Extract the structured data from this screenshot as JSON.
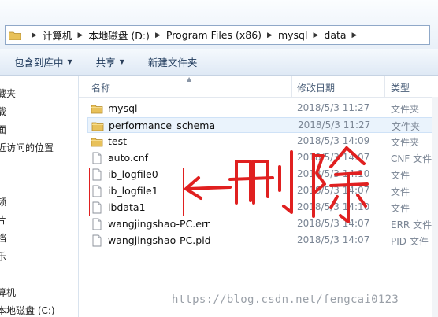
{
  "address_bar": {
    "crumbs": [
      "计算机",
      "本地磁盘 (D:)",
      "Program Files (x86)",
      "mysql",
      "data"
    ]
  },
  "toolbar": {
    "include_in_library": "包含到库中",
    "share": "共享",
    "new_folder": "新建文件夹"
  },
  "nav_pane": {
    "items": [
      "藏夹",
      "载",
      "面",
      "近访问的位置",
      "频",
      "片",
      "档",
      "乐",
      "算机",
      "本地磁盘 (C:)"
    ]
  },
  "columns": {
    "name": "名称",
    "modified": "修改日期",
    "type": "类型"
  },
  "files": [
    {
      "name": "mysql",
      "modified": "2018/5/3 11:27",
      "type": "文件夹",
      "icon": "folder-icon"
    },
    {
      "name": "performance_schema",
      "modified": "2018/5/3 11:27",
      "type": "文件夹",
      "icon": "folder-icon",
      "selected": true
    },
    {
      "name": "test",
      "modified": "2018/5/3 14:09",
      "type": "文件夹",
      "icon": "folder-icon"
    },
    {
      "name": "auto.cnf",
      "modified": "2018/5/3 14:07",
      "type": "CNF 文件",
      "icon": "file-icon"
    },
    {
      "name": "ib_logfile0",
      "modified": "2018/5/3 14:10",
      "type": "文件",
      "icon": "file-icon"
    },
    {
      "name": "ib_logfile1",
      "modified": "2018/5/3 14:07",
      "type": "文件",
      "icon": "file-icon"
    },
    {
      "name": "ibdata1",
      "modified": "2018/5/3 14:10",
      "type": "文件",
      "icon": "file-icon"
    },
    {
      "name": "wangjingshao-PC.err",
      "modified": "2018/5/3 14:07",
      "type": "ERR 文件",
      "icon": "file-icon"
    },
    {
      "name": "wangjingshao-PC.pid",
      "modified": "2018/5/3 14:07",
      "type": "PID 文件",
      "icon": "file-icon"
    }
  ],
  "annotation": {
    "text": "删除",
    "color": "#e02020"
  },
  "watermark": "https://blog.csdn.net/fengcai0123"
}
